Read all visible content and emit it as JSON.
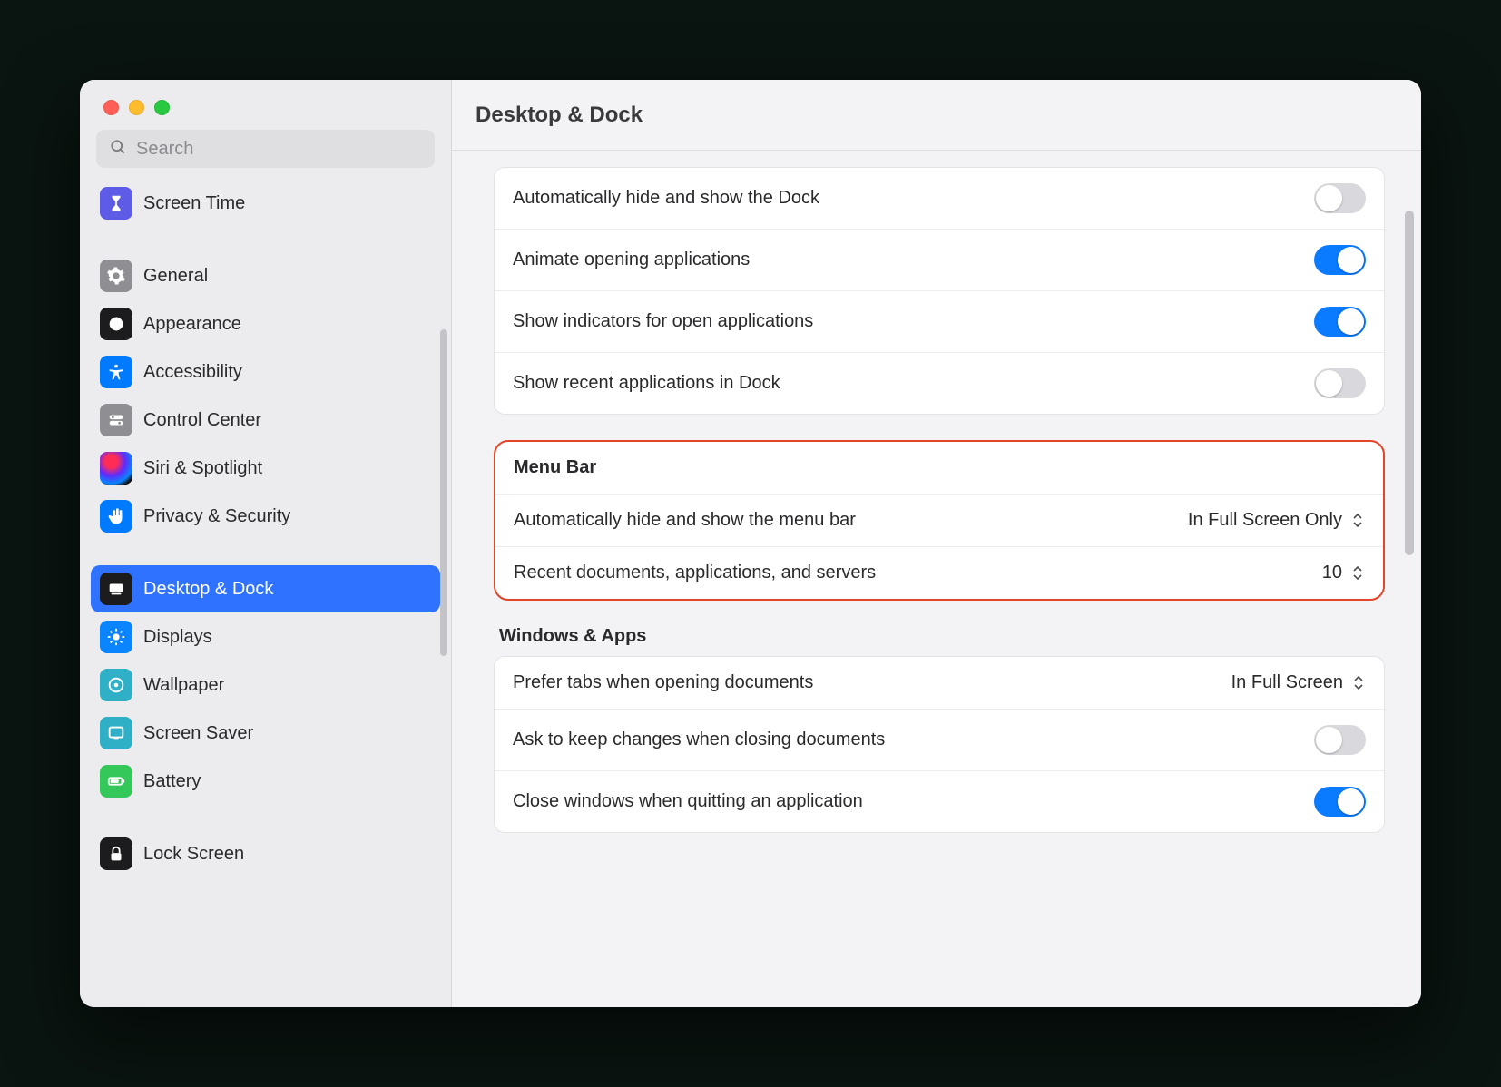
{
  "header": {
    "title": "Desktop & Dock"
  },
  "search": {
    "placeholder": "Search"
  },
  "sidebar": {
    "items": [
      {
        "label": "Screen Time"
      },
      {
        "label": "General"
      },
      {
        "label": "Appearance"
      },
      {
        "label": "Accessibility"
      },
      {
        "label": "Control Center"
      },
      {
        "label": "Siri & Spotlight"
      },
      {
        "label": "Privacy & Security"
      },
      {
        "label": "Desktop & Dock"
      },
      {
        "label": "Displays"
      },
      {
        "label": "Wallpaper"
      },
      {
        "label": "Screen Saver"
      },
      {
        "label": "Battery"
      },
      {
        "label": "Lock Screen"
      }
    ]
  },
  "dock": {
    "rows": [
      {
        "label": "Automatically hide and show the Dock",
        "on": false
      },
      {
        "label": "Animate opening applications",
        "on": true
      },
      {
        "label": "Show indicators for open applications",
        "on": true
      },
      {
        "label": "Show recent applications in Dock",
        "on": false
      }
    ]
  },
  "menubar": {
    "title": "Menu Bar",
    "rows": [
      {
        "label": "Automatically hide and show the menu bar",
        "value": "In Full Screen Only"
      },
      {
        "label": "Recent documents, applications, and servers",
        "value": "10"
      }
    ]
  },
  "windows": {
    "title": "Windows & Apps",
    "rows": {
      "prefer_tabs": {
        "label": "Prefer tabs when opening documents",
        "value": "In Full Screen"
      },
      "ask_keep": {
        "label": "Ask to keep changes when closing documents",
        "on": false
      },
      "close_quit": {
        "label": "Close windows when quitting an application",
        "on": true
      }
    }
  }
}
